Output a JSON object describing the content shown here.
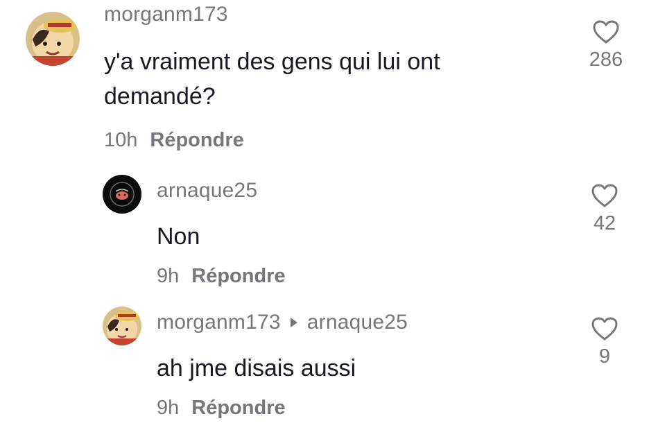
{
  "comments": [
    {
      "username": "morganm173",
      "text": "y'a vraiment des gens qui lui ont demandé?",
      "time": "10h",
      "reply_label": "Répondre",
      "likes": "286",
      "avatar_icon": "anime-character-avatar"
    },
    {
      "username": "arnaque25",
      "text": "Non",
      "time": "9h",
      "reply_label": "Répondre",
      "likes": "42",
      "avatar_icon": "dark-logo-avatar"
    },
    {
      "username": "morganm173",
      "reply_to": "arnaque25",
      "text": "ah jme disais aussi",
      "time": "9h",
      "reply_label": "Répondre",
      "likes": "9",
      "avatar_icon": "anime-character-avatar"
    }
  ],
  "colors": {
    "text": "#161823",
    "secondary": "#75767c",
    "background": "#ffffff"
  }
}
